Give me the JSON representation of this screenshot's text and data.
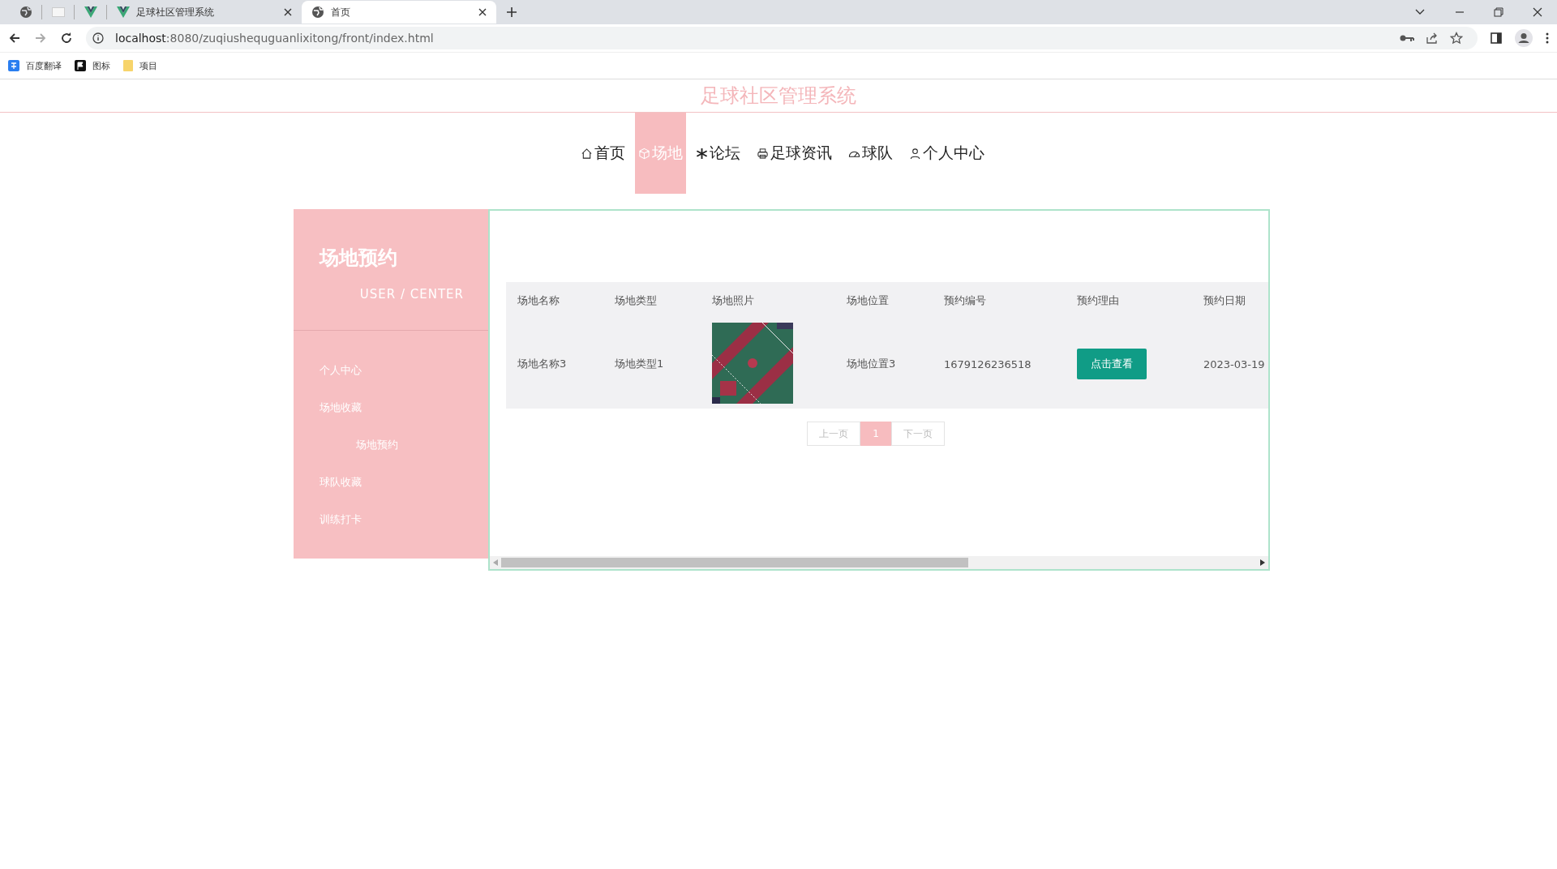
{
  "browser": {
    "tabs": [
      {
        "kind": "pinned",
        "selected": false
      },
      {
        "kind": "pinned",
        "selected": false
      },
      {
        "kind": "pinned",
        "selected": false
      },
      {
        "kind": "page",
        "title": "足球社区管理系统",
        "selected": false
      },
      {
        "kind": "page",
        "title": "首页",
        "selected": true
      }
    ],
    "url_host": "localhost",
    "url_rest": ":8080/zuqiushequguanlixitong/front/index.html",
    "bookmarks": [
      "百度翻译",
      "图标",
      "项目"
    ]
  },
  "site_title": "足球社区管理系统",
  "nav": [
    {
      "label": "首页",
      "selected": false
    },
    {
      "label": "场地",
      "selected": true
    },
    {
      "label": "论坛",
      "selected": false
    },
    {
      "label": "足球资讯",
      "selected": false
    },
    {
      "label": "球队",
      "selected": false
    },
    {
      "label": "个人中心",
      "selected": false
    }
  ],
  "sidebar": {
    "title": "场地预约",
    "subtitle": "USER / CENTER",
    "items": [
      {
        "label": "个人中心"
      },
      {
        "label": "场地收藏",
        "children": [
          {
            "label": "场地预约"
          }
        ]
      },
      {
        "label": "球队收藏"
      },
      {
        "label": "训练打卡"
      }
    ]
  },
  "table": {
    "columns": [
      "场地名称",
      "场地类型",
      "场地照片",
      "场地位置",
      "预约编号",
      "预约理由",
      "预约日期"
    ],
    "rows": [
      [
        {
          "kind": "text",
          "text": "场地名称3"
        },
        {
          "kind": "text",
          "text": "场地类型1"
        },
        {
          "kind": "picture"
        },
        {
          "kind": "text",
          "text": "场地位置3"
        },
        {
          "kind": "text",
          "text": "1679126236518"
        },
        {
          "kind": "button",
          "text": "点击查看"
        },
        {
          "kind": "text",
          "text": "2023-03-19"
        }
      ]
    ]
  },
  "pagination": {
    "prev": {
      "label": "上一页",
      "disabled": true
    },
    "pages": [
      {
        "label": "1",
        "selected": true
      }
    ],
    "next": {
      "label": "下一页",
      "disabled": true
    }
  }
}
